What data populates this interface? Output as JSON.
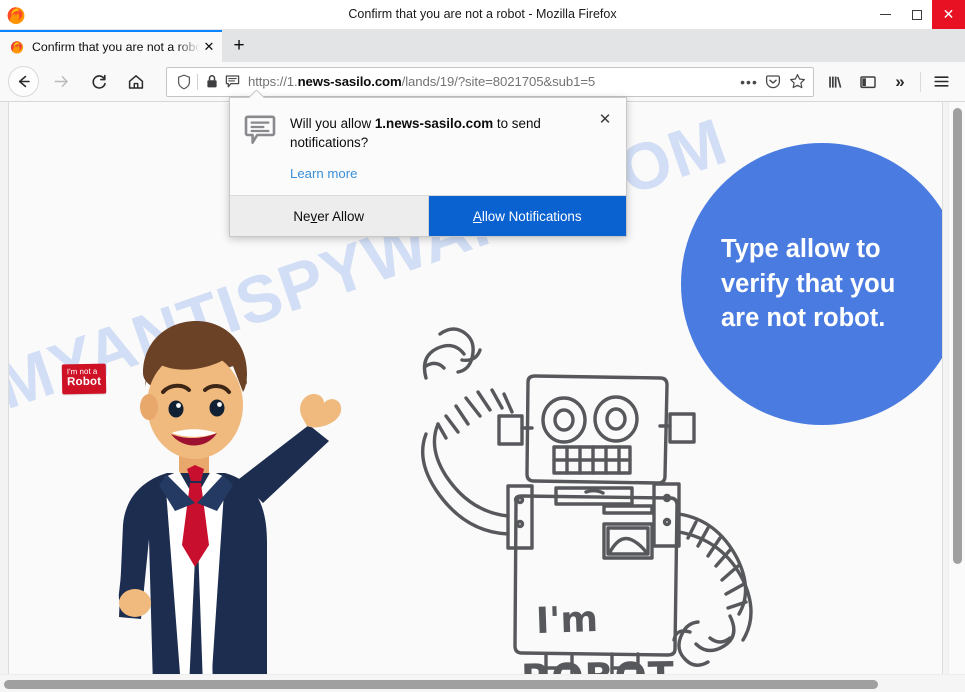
{
  "window": {
    "title": "Confirm that you are not a robot - Mozilla Firefox",
    "minimize_label": "—",
    "maximize_label": "□",
    "close_label": "✕"
  },
  "tabs": {
    "items": [
      {
        "title": "Confirm that you are not a robot",
        "close_label": "✕"
      }
    ],
    "new_tab_label": "+"
  },
  "toolbar": {
    "back_label": "←",
    "forward_label": "→",
    "reload_label": "↻",
    "home_label": "⌂",
    "menu_label": "☰",
    "overflow_label": "»"
  },
  "urlbar": {
    "scheme": "https://1.",
    "domain": "news-sasilo.com",
    "path": "/lands/19/?site=8021705&sub1=5",
    "full_url": "https://1.news-sasilo.com/lands/19/?site=8021705&sub1=5",
    "ellipsis_label": "•••"
  },
  "notification_popup": {
    "question_prefix": "Will you allow ",
    "question_domain": "1.news-sasilo.com",
    "question_suffix": " to send notifications?",
    "learn_more_label": "Learn more",
    "close_label": "✕",
    "deny_label": "Never Allow",
    "deny_accesskey": "v",
    "allow_label": "Allow Notifications",
    "allow_accesskey": "A",
    "icon": "speech-bubble-icon",
    "primary_color": "#0a62d0",
    "link_color": "#3a8fd8"
  },
  "page": {
    "watermark": "MYANTISPYWARE.COM",
    "watermark_color": "#b9cdf2",
    "circle": {
      "text": "Type allow to verify that you are not robot.",
      "background_color": "#4a7be0",
      "text_color": "#ffffff"
    },
    "man": {
      "badge_line1": "I'm not a",
      "badge_line2": "Robot",
      "badge_color": "#cf1126",
      "suit_color": "#1d2d4f",
      "tie_color": "#c8102e",
      "skin_color": "#f0b97d",
      "hair_color": "#6b4226"
    },
    "robot": {
      "line1": "I'm",
      "line2": "ROBOT",
      "sketch_color": "#57585c"
    }
  },
  "scrollbars": {
    "vertical_present": true,
    "horizontal_present": true
  }
}
